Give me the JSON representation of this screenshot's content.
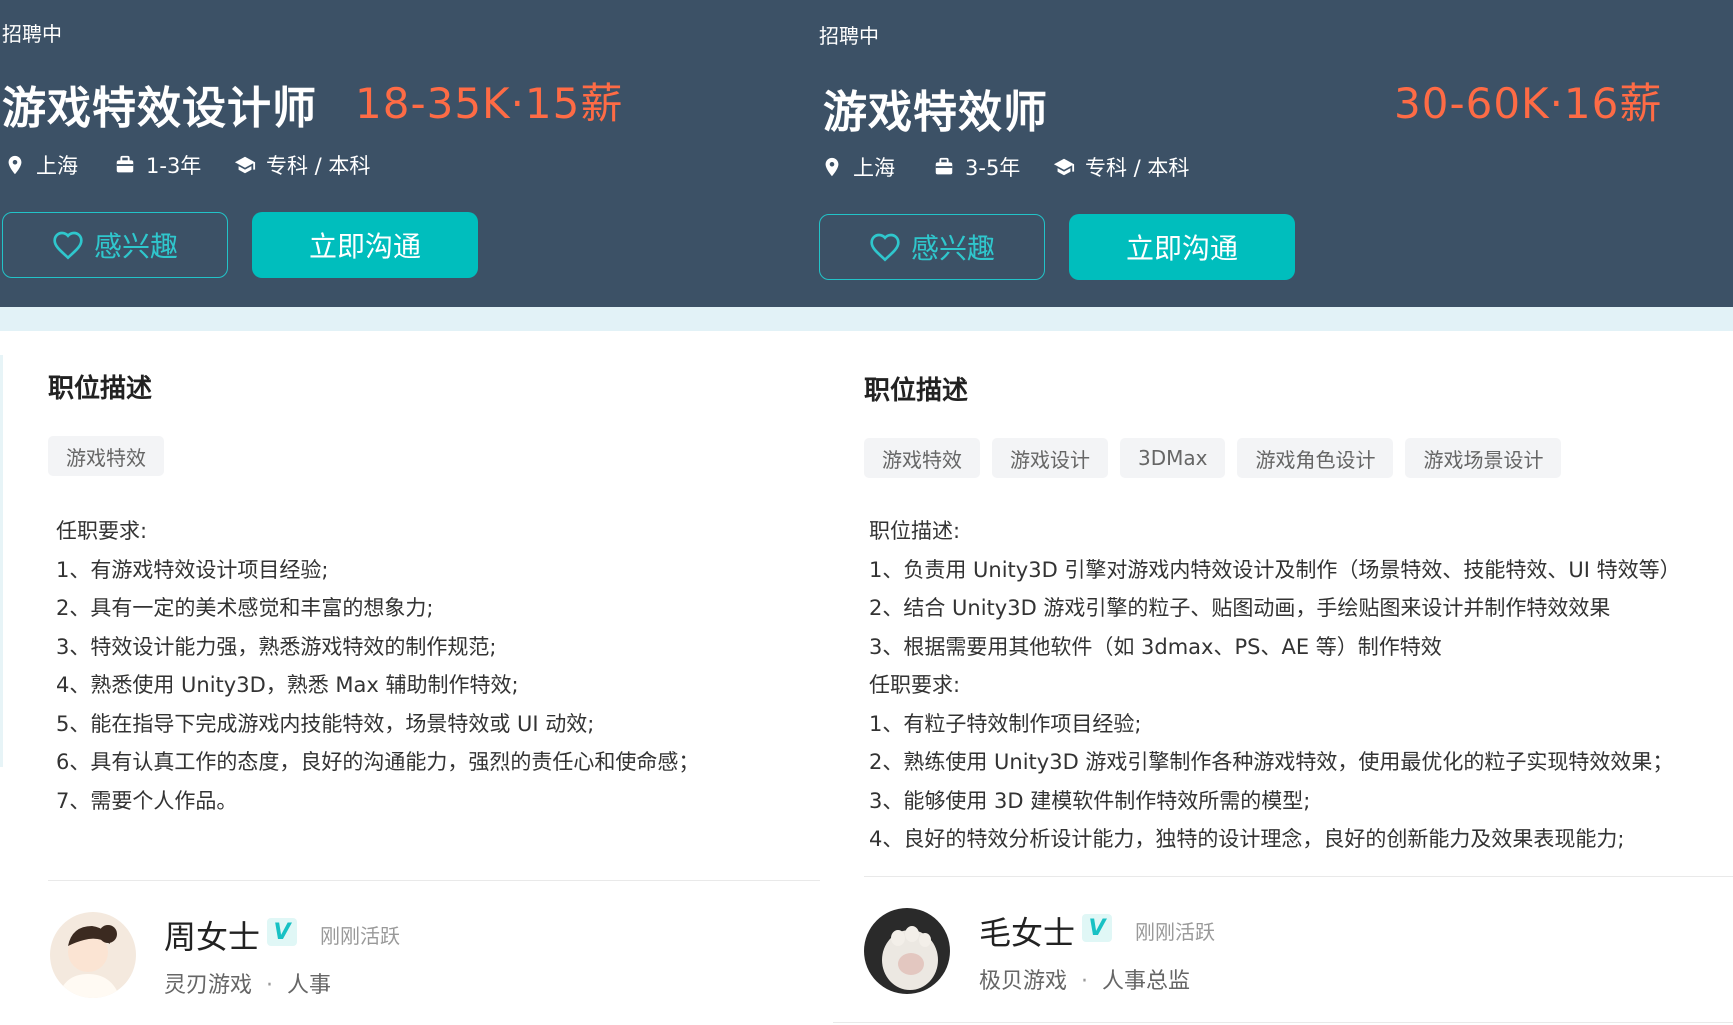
{
  "left": {
    "status": "招聘中",
    "title": "游戏特效设计师",
    "salary": "18-35K·15薪",
    "location": "上海",
    "experience": "1-3年",
    "education": "专科 / 本科",
    "interest_label": "感兴趣",
    "chat_label": "立即沟通",
    "section_title": "职位描述",
    "tags": [
      "游戏特效"
    ],
    "description": [
      "任职要求:",
      "1、有游戏特效设计项目经验;",
      "2、具有一定的美术感觉和丰富的想象力;",
      "3、特效设计能力强，熟悉游戏特效的制作规范;",
      "4、熟悉使用 Unity3D，熟悉 Max 辅助制作特效;",
      "5、能在指导下完成游戏内技能特效，场景特效或 UI 动效;",
      "6、具有认真工作的态度，良好的沟通能力，强烈的责任心和使命感；",
      "7、需要个人作品。"
    ],
    "recruiter": {
      "name": "周女士",
      "verified_mark": "V",
      "active": "刚刚活跃",
      "company": "灵刃游戏",
      "separator": "·",
      "role": "人事"
    }
  },
  "right": {
    "status": "招聘中",
    "title": "游戏特效师",
    "salary": "30-60K·16薪",
    "location": "上海",
    "experience": "3-5年",
    "education": "专科 / 本科",
    "interest_label": "感兴趣",
    "chat_label": "立即沟通",
    "section_title": "职位描述",
    "tags": [
      "游戏特效",
      "游戏设计",
      "3DMax",
      "游戏角色设计",
      "游戏场景设计"
    ],
    "description": [
      "职位描述:",
      "1、负责用 Unity3D 引擎对游戏内特效设计及制作（场景特效、技能特效、UI 特效等）",
      "2、结合 Unity3D 游戏引擎的粒子、贴图动画，手绘贴图来设计并制作特效效果",
      "3、根据需要用其他软件（如 3dmax、PS、AE 等）制作特效",
      "任职要求:",
      "1、有粒子特效制作项目经验;",
      "2、熟练使用 Unity3D 游戏引擎制作各种游戏特效，使用最优化的粒子实现特效效果；",
      "3、能够使用 3D 建模软件制作特效所需的模型;",
      "4、良好的特效分析设计能力，独特的设计理念，良好的创新能力及效果表现能力;"
    ],
    "recruiter": {
      "name": "毛女士",
      "verified_mark": "V",
      "active": "刚刚活跃",
      "company": "极贝游戏",
      "separator": "·",
      "role": "人事总监"
    }
  },
  "colors": {
    "header_bg": "#3c5166",
    "salary": "#fe6b45",
    "accent": "#00bebd"
  },
  "icons": [
    "location-icon",
    "briefcase-icon",
    "graduation-cap-icon",
    "heart-icon",
    "verified-icon"
  ]
}
